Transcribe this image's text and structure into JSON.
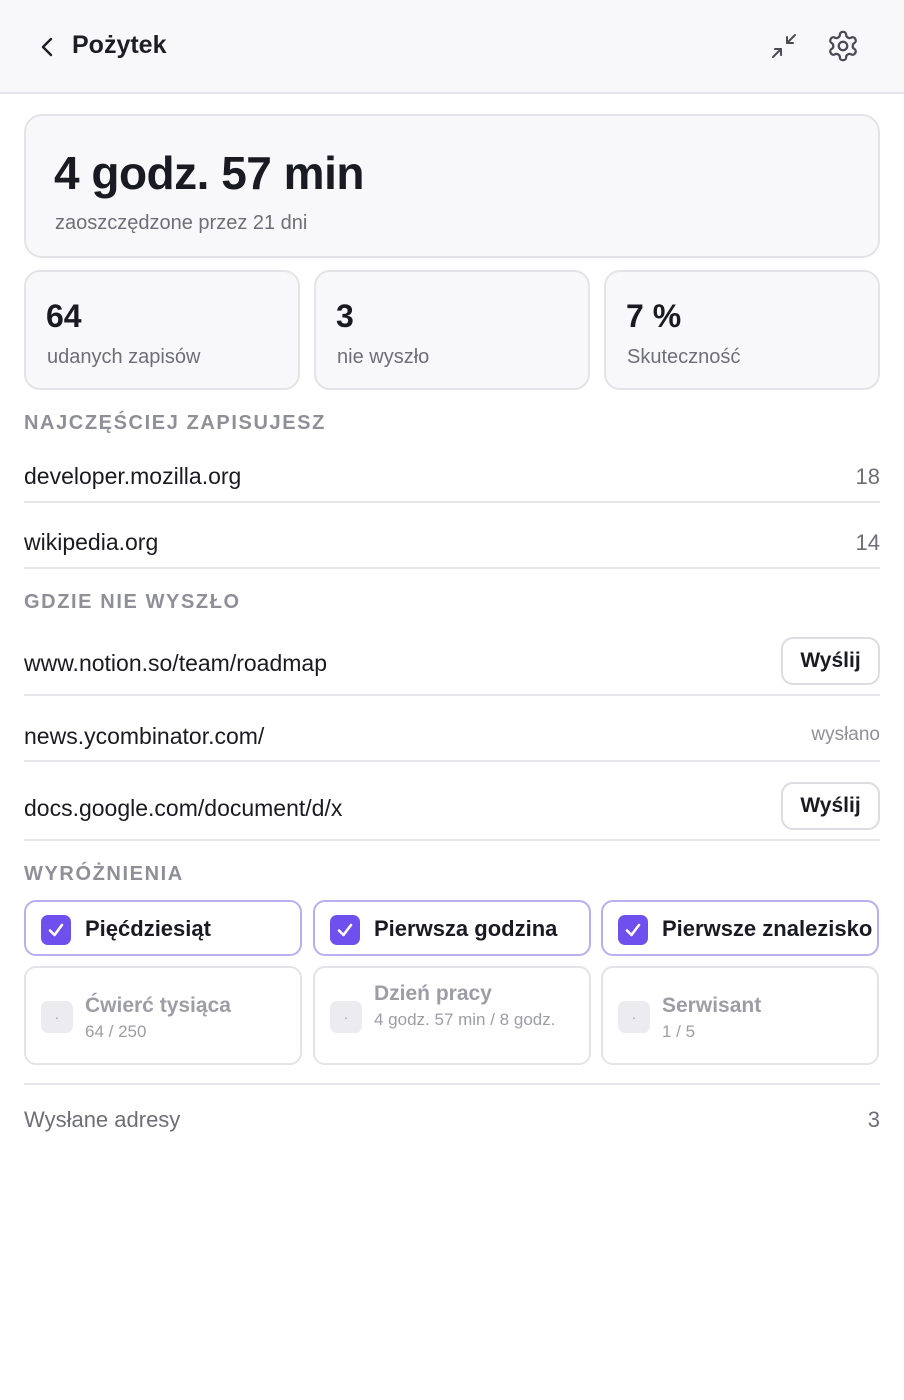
{
  "header": {
    "title": "Pożytek",
    "back_icon": "chevron-left-icon",
    "collapse_icon": "collapse-arrows-icon",
    "settings_icon": "gear-icon"
  },
  "summary": {
    "time_saved": "4 godz. 57 min",
    "subtitle": "zaoszczędzone przez 21 dni"
  },
  "stats": [
    {
      "value": "64",
      "label": "udanych zapisów"
    },
    {
      "value": "3",
      "label": "nie wyszło"
    },
    {
      "value": "7 %",
      "label": "Skuteczność"
    }
  ],
  "top_sites": {
    "title": "NAJCZĘŚCIEJ ZAPISUJESZ",
    "items": [
      {
        "domain": "developer.mozilla.org",
        "count": "18"
      },
      {
        "domain": "wikipedia.org",
        "count": "14"
      }
    ]
  },
  "failures": {
    "title": "GDZIE NIE WYSZŁO",
    "items": [
      {
        "url": "www.notion.so/team/roadmap",
        "action": "Wyślij"
      },
      {
        "url": "news.ycombinator.com/",
        "status": "wysłano"
      },
      {
        "url": "docs.google.com/document/d/x",
        "action": "Wyślij"
      }
    ]
  },
  "achievements": {
    "title": "WYRÓŻNIENIA",
    "earned": [
      {
        "name": "Pięćdziesiąt"
      },
      {
        "name": "Pierwsza godzina"
      },
      {
        "name": "Pierwsze znalezisko"
      }
    ],
    "locked": [
      {
        "name": "Ćwierć tysiąca",
        "progress": "64 / 250"
      },
      {
        "name": "Dzień pracy",
        "progress": "4 godz. 57 min / 8 godz."
      },
      {
        "name": "Serwisant",
        "progress": "1 / 5"
      }
    ],
    "lock_glyph": "·"
  },
  "footer": {
    "label": "Wysłane adresy",
    "value": "3"
  },
  "colors": {
    "accent": "#6d50ee",
    "badge_border": "#b8aff1",
    "card_bg": "#f8f8fa",
    "muted_text": "#6e6e78"
  }
}
